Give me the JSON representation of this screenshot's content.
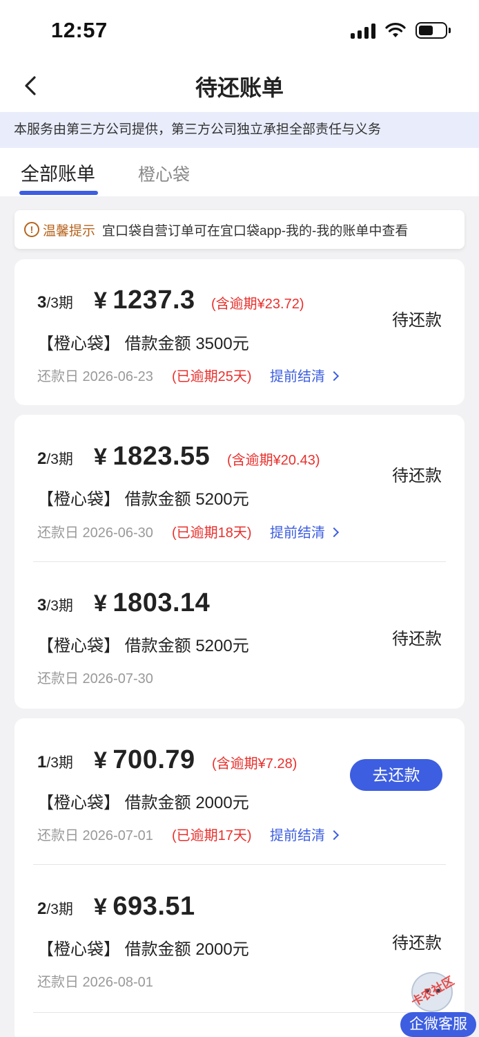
{
  "status_bar": {
    "time": "12:57"
  },
  "nav": {
    "title": "待还账单"
  },
  "notice": {
    "text": "本服务由第三方公司提供，第三方公司独立承担全部责任与义务"
  },
  "tabs": [
    {
      "label": "全部账单",
      "active": true
    },
    {
      "label": "橙心袋",
      "active": false
    }
  ],
  "tip": {
    "label": "温馨提示",
    "text": "宜口袋自营订单可在宜口袋app-我的-我的账单中查看"
  },
  "bills": [
    {
      "period_current": "3",
      "period_total": "/3期",
      "yen": "¥",
      "amount": "1237.3",
      "overdue_amount": "(含逾期¥23.72)",
      "product": "【橙心袋】",
      "loan": "借款金额 3500元",
      "due_date": "还款日 2026-06-23",
      "overdue_days": "(已逾期25天)",
      "early_label": "提前结清",
      "status": "待还款"
    },
    {
      "period_current": "2",
      "period_total": "/3期",
      "yen": "¥",
      "amount": "1823.55",
      "overdue_amount": "(含逾期¥20.43)",
      "product": "【橙心袋】",
      "loan": "借款金额 5200元",
      "due_date": "还款日 2026-06-30",
      "overdue_days": "(已逾期18天)",
      "early_label": "提前结清",
      "status": "待还款"
    },
    {
      "period_current": "3",
      "period_total": "/3期",
      "yen": "¥",
      "amount": "1803.14",
      "product": "【橙心袋】",
      "loan": "借款金额 5200元",
      "due_date": "还款日 2026-07-30",
      "status": "待还款"
    },
    {
      "period_current": "1",
      "period_total": "/3期",
      "yen": "¥",
      "amount": "700.79",
      "overdue_amount": "(含逾期¥7.28)",
      "product": "【橙心袋】",
      "loan": "借款金额 2000元",
      "due_date": "还款日 2026-07-01",
      "overdue_days": "(已逾期17天)",
      "early_label": "提前结清",
      "action": "去还款"
    },
    {
      "period_current": "2",
      "period_total": "/3期",
      "yen": "¥",
      "amount": "693.51",
      "product": "【橙心袋】",
      "loan": "借款金额 2000元",
      "due_date": "还款日 2026-08-01",
      "status": "待还款"
    }
  ],
  "service": {
    "label": "企微客服",
    "watermark": "卡农社区"
  },
  "colors": {
    "accent": "#3d5ee0",
    "overdue": "#e8302c",
    "tip": "#b5631c",
    "banner_bg": "#e9edfb"
  }
}
